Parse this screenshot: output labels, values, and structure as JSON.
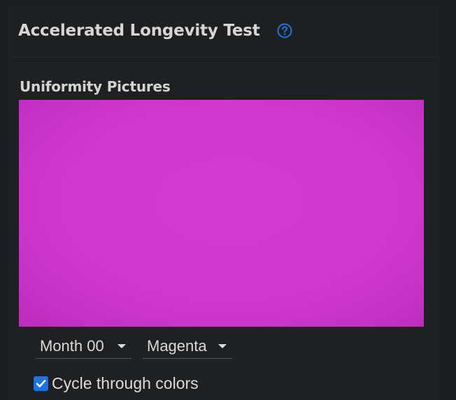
{
  "panel": {
    "title": "Accelerated Longevity Test",
    "help_icon": "question-circle-icon"
  },
  "uniformity": {
    "label": "Uniformity Pictures",
    "picture_color": "#cf38cf",
    "month_select": {
      "value": "Month 00"
    },
    "color_select": {
      "value": "Magenta"
    },
    "cycle_checkbox": {
      "label": "Cycle through colors",
      "checked": true
    }
  },
  "colors": {
    "background": "#1b1d1f",
    "panel": "#1e2022",
    "accent": "#1a73e8",
    "text": "#d7d7d7"
  }
}
